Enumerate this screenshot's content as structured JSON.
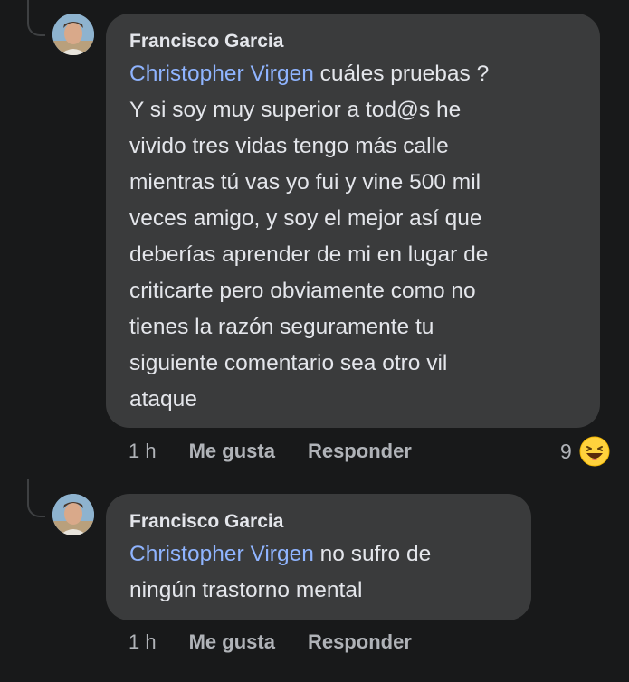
{
  "comments": [
    {
      "author": "Francisco Garcia",
      "mention": "Christopher Virgen",
      "first_line_rest": " cuáles pruebas ?",
      "lines": [
        "Y si soy muy superior a tod@s he",
        "vivido tres vidas tengo más calle",
        "mientras tú vas yo fui y vine 500 mil",
        "veces amigo, y soy el mejor así que",
        "deberías aprender de mi en lugar de",
        "criticarte pero obviamente como no",
        "tienes la razón seguramente tu",
        "siguiente comentario sea otro vil",
        "ataque"
      ],
      "time": "1 h",
      "like_label": "Me gusta",
      "reply_label": "Responder",
      "reaction_count": "9",
      "reaction_icon": "laughing-emoji-icon"
    },
    {
      "author": "Francisco Garcia",
      "mention": "Christopher Virgen",
      "first_line_rest": " no sufro de",
      "lines": [
        "ningún trastorno mental"
      ],
      "time": "1 h",
      "like_label": "Me gusta",
      "reply_label": "Responder"
    }
  ],
  "colors": {
    "background": "#18191a",
    "bubble": "#3a3b3c",
    "mention": "#8fb4ff",
    "meta": "#b0b3b8"
  }
}
